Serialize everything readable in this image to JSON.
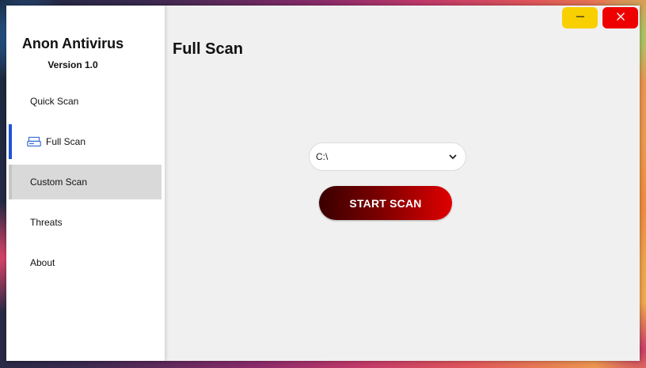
{
  "app": {
    "title": "Anon Antivirus",
    "version": "Version 1.0"
  },
  "sidebar": {
    "items": [
      {
        "label": "Quick Scan",
        "state": "normal"
      },
      {
        "label": "Full Scan",
        "state": "active",
        "icon": "drive-icon"
      },
      {
        "label": "Custom Scan",
        "state": "hover"
      },
      {
        "label": "Threats",
        "state": "normal"
      },
      {
        "label": "About",
        "state": "normal"
      }
    ]
  },
  "main": {
    "title": "Full Scan",
    "drive_select": {
      "value": "C:\\",
      "icon": "chevron-down-icon"
    },
    "start_button_label": "START SCAN"
  },
  "window_controls": {
    "minimize_icon": "minimize-icon",
    "close_icon": "close-icon"
  },
  "colors": {
    "accent": "#1f55d6",
    "minimize": "#f8d000",
    "close": "#ee0000",
    "start_button_dark": "#3a0000",
    "start_button_light": "#e00000"
  }
}
